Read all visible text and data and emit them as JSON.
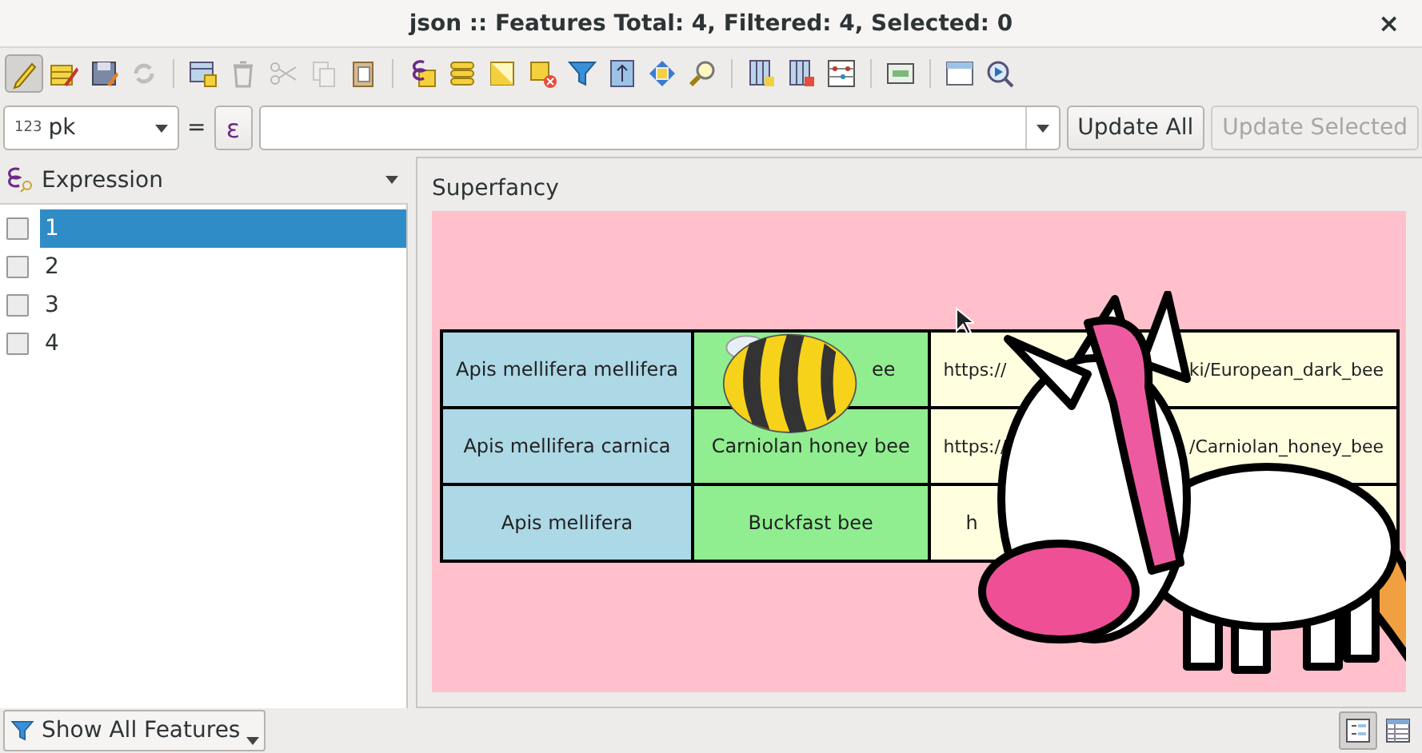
{
  "window": {
    "title": "json :: Features Total: 4, Filtered: 4, Selected: 0",
    "close": "×"
  },
  "toolbar": [
    {
      "kind": "pencil",
      "pressed": true,
      "disabled": false
    },
    {
      "kind": "tableedit",
      "pressed": false,
      "disabled": false
    },
    {
      "kind": "save",
      "pressed": false,
      "disabled": false
    },
    {
      "kind": "refresh",
      "pressed": false,
      "disabled": true
    },
    {
      "kind": "separator"
    },
    {
      "kind": "addrow",
      "pressed": false,
      "disabled": false
    },
    {
      "kind": "trash",
      "pressed": false,
      "disabled": true
    },
    {
      "kind": "cut",
      "pressed": false,
      "disabled": true
    },
    {
      "kind": "copy",
      "pressed": false,
      "disabled": true
    },
    {
      "kind": "paste",
      "pressed": false,
      "disabled": false
    },
    {
      "kind": "separator"
    },
    {
      "kind": "exprsel",
      "pressed": false,
      "disabled": false
    },
    {
      "kind": "selall",
      "pressed": false,
      "disabled": false
    },
    {
      "kind": "invert",
      "pressed": false,
      "disabled": false
    },
    {
      "kind": "deselect",
      "pressed": false,
      "disabled": false
    },
    {
      "kind": "filter",
      "pressed": false,
      "disabled": false
    },
    {
      "kind": "movetop",
      "pressed": false,
      "disabled": false
    },
    {
      "kind": "pan",
      "pressed": false,
      "disabled": false
    },
    {
      "kind": "zoom",
      "pressed": false,
      "disabled": false
    },
    {
      "kind": "separator"
    },
    {
      "kind": "newfield",
      "pressed": false,
      "disabled": false
    },
    {
      "kind": "delfield",
      "pressed": false,
      "disabled": false
    },
    {
      "kind": "calc",
      "pressed": false,
      "disabled": false
    },
    {
      "kind": "separator"
    },
    {
      "kind": "cond",
      "pressed": false,
      "disabled": false
    },
    {
      "kind": "separator"
    },
    {
      "kind": "dock",
      "pressed": false,
      "disabled": false
    },
    {
      "kind": "actions",
      "pressed": false,
      "disabled": false
    }
  ],
  "field_bar": {
    "field_type": "123",
    "field": "pk",
    "equals": "=",
    "expression_button": "ε",
    "update_all": {
      "label": "Update All",
      "disabled": false
    },
    "update_selected": {
      "label": "Update Selected",
      "disabled": true
    }
  },
  "feature_list": {
    "header": "Expression",
    "items": [
      {
        "label": "1",
        "checked": false,
        "selected": true
      },
      {
        "label": "2",
        "checked": false,
        "selected": false
      },
      {
        "label": "3",
        "checked": false,
        "selected": false
      },
      {
        "label": "4",
        "checked": false,
        "selected": false
      }
    ]
  },
  "form": {
    "label": "Superfancy",
    "table": {
      "rows": [
        [
          {
            "color": "#add8e6",
            "parts": [
              "Apis mellifera mellifera"
            ]
          },
          {
            "color": "#90ee90",
            "parts": [
              "ee"
            ]
          },
          {
            "color": "#ffffe0",
            "parts": [
              "https://",
              "ki/European_dark_bee"
            ]
          }
        ],
        [
          {
            "color": "#add8e6",
            "parts": [
              "Apis mellifera carnica"
            ]
          },
          {
            "color": "#90ee90",
            "parts": [
              "Carniolan honey bee"
            ]
          },
          {
            "color": "#ffffe0",
            "parts": [
              "https://",
              "/Carniolan_honey_bee"
            ]
          }
        ],
        [
          {
            "color": "#add8e6",
            "parts": [
              "Apis mellifera"
            ]
          },
          {
            "color": "#90ee90",
            "parts": [
              "Buckfast bee"
            ]
          },
          {
            "color": "#ffffe0",
            "parts": [
              "h"
            ]
          }
        ]
      ]
    }
  },
  "footer": {
    "filter_button": "Show All Features",
    "views": [
      {
        "kind": "form",
        "selected": true
      },
      {
        "kind": "table",
        "selected": false
      }
    ]
  }
}
